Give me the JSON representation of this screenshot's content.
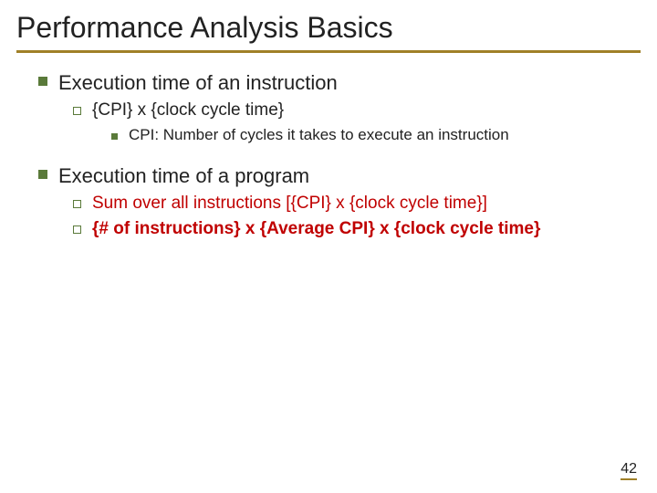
{
  "title": "Performance Analysis Basics",
  "section1": {
    "heading": "Execution time of an instruction",
    "formula": "{CPI}  x  {clock cycle time}",
    "note": "CPI: Number of cycles it takes to execute an instruction"
  },
  "section2": {
    "heading": "Execution time of a program",
    "line1": "Sum over all instructions [{CPI}  x  {clock cycle time}]",
    "line2": "{# of instructions}  x  {Average CPI}  x  {clock cycle time}"
  },
  "page": "42"
}
